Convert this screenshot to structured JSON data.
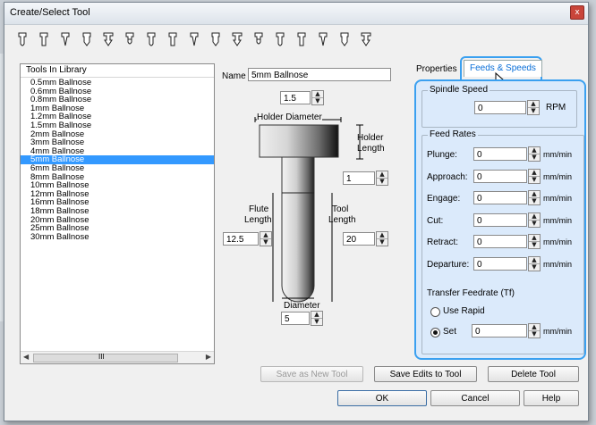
{
  "window": {
    "title": "Create/Select Tool",
    "close_glyph": "x"
  },
  "toolbar": {
    "icons": [
      "ballnose-tool-icon",
      "end-mill-icon",
      "tapered-ballnose-icon",
      "tapered-mill-icon",
      "v-bit-icon",
      "drill-icon",
      "form-tool-icon",
      "engraving-tool-icon",
      "chamfer-tool-icon",
      "radiused-tool-icon",
      "diamond-drag-icon",
      "dovetail-tool-icon",
      "keyhole-tool-icon",
      "slot-cutter-icon",
      "thread-mill-icon",
      "custom-tool-icon",
      "bull-nose-icon"
    ]
  },
  "library": {
    "header": "Tools In Library",
    "items": [
      "0.5mm Ballnose",
      "0.6mm Ballnose",
      "0.8mm Ballnose",
      "1mm Ballnose",
      "1.2mm Ballnose",
      "1.5mm Ballnose",
      "2mm Ballnose",
      "3mm Ballnose",
      "4mm Ballnose",
      "5mm Ballnose",
      "6mm Ballnose",
      "8mm Ballnose",
      "10mm Ballnose",
      "12mm Ballnose",
      "16mm Ballnose",
      "18mm Ballnose",
      "20mm Ballnose",
      "25mm Ballnose",
      "30mm Ballnose"
    ],
    "selected_index": 9,
    "scroll_thumb_glyph": "III"
  },
  "geometry": {
    "name_label": "Name",
    "name_value": "5mm Ballnose",
    "holder_diameter_value": "1.5",
    "holder_diameter_label": "Holder Diameter",
    "holder_length_label_1": "Holder",
    "holder_length_label_2": "Length",
    "holder_length_value": "1",
    "flute_length_label_1": "Flute",
    "flute_length_label_2": "Length",
    "flute_length_value": "12.5",
    "tool_length_label_1": "Tool",
    "tool_length_label_2": "Length",
    "tool_length_value": "20",
    "diameter_label": "Diameter",
    "diameter_value": "5"
  },
  "tabs": {
    "properties": "Properties",
    "feeds": "Feeds & Speeds"
  },
  "feeds": {
    "spindle_group": "Spindle Speed",
    "spindle_value": "0",
    "spindle_unit": "RPM",
    "feed_group": "Feed Rates",
    "rates": [
      {
        "label": "Plunge:",
        "value": "0",
        "unit": "mm/min"
      },
      {
        "label": "Approach:",
        "value": "0",
        "unit": "mm/min"
      },
      {
        "label": "Engage:",
        "value": "0",
        "unit": "mm/min"
      },
      {
        "label": "Cut:",
        "value": "0",
        "unit": "mm/min"
      },
      {
        "label": "Retract:",
        "value": "0",
        "unit": "mm/min"
      },
      {
        "label": "Departure:",
        "value": "0",
        "unit": "mm/min"
      }
    ],
    "transfer_label": "Transfer Feedrate (Tf)",
    "use_rapid": "Use Rapid",
    "set_label": "Set",
    "set_value": "0",
    "set_unit": "mm/min"
  },
  "buttons": {
    "save_new": "Save as New Tool",
    "save_edits": "Save Edits to Tool",
    "delete": "Delete Tool",
    "ok": "OK",
    "cancel": "Cancel",
    "help": "Help"
  },
  "colors": {
    "selection": "#3399ff",
    "highlight": "#3aa0f0",
    "panel": "#dbeafb"
  }
}
